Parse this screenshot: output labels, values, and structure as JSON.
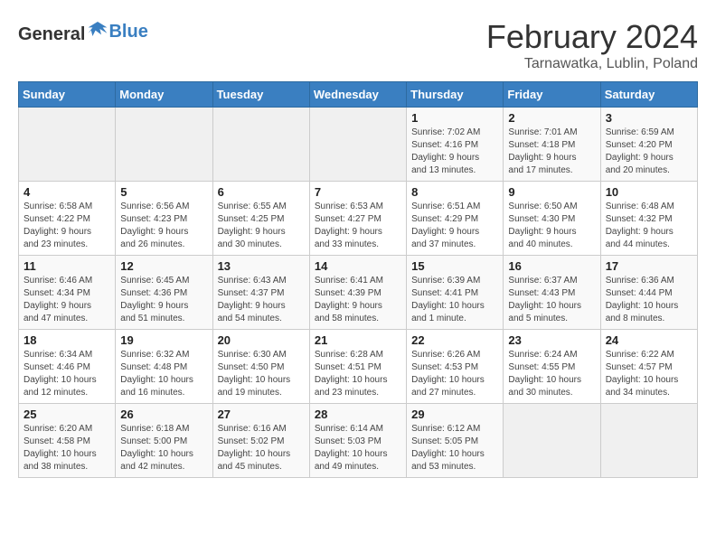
{
  "header": {
    "logo_general": "General",
    "logo_blue": "Blue",
    "month_title": "February 2024",
    "location": "Tarnawatka, Lublin, Poland"
  },
  "weekdays": [
    "Sunday",
    "Monday",
    "Tuesday",
    "Wednesday",
    "Thursday",
    "Friday",
    "Saturday"
  ],
  "weeks": [
    [
      {
        "day": "",
        "info": ""
      },
      {
        "day": "",
        "info": ""
      },
      {
        "day": "",
        "info": ""
      },
      {
        "day": "",
        "info": ""
      },
      {
        "day": "1",
        "info": "Sunrise: 7:02 AM\nSunset: 4:16 PM\nDaylight: 9 hours\nand 13 minutes."
      },
      {
        "day": "2",
        "info": "Sunrise: 7:01 AM\nSunset: 4:18 PM\nDaylight: 9 hours\nand 17 minutes."
      },
      {
        "day": "3",
        "info": "Sunrise: 6:59 AM\nSunset: 4:20 PM\nDaylight: 9 hours\nand 20 minutes."
      }
    ],
    [
      {
        "day": "4",
        "info": "Sunrise: 6:58 AM\nSunset: 4:22 PM\nDaylight: 9 hours\nand 23 minutes."
      },
      {
        "day": "5",
        "info": "Sunrise: 6:56 AM\nSunset: 4:23 PM\nDaylight: 9 hours\nand 26 minutes."
      },
      {
        "day": "6",
        "info": "Sunrise: 6:55 AM\nSunset: 4:25 PM\nDaylight: 9 hours\nand 30 minutes."
      },
      {
        "day": "7",
        "info": "Sunrise: 6:53 AM\nSunset: 4:27 PM\nDaylight: 9 hours\nand 33 minutes."
      },
      {
        "day": "8",
        "info": "Sunrise: 6:51 AM\nSunset: 4:29 PM\nDaylight: 9 hours\nand 37 minutes."
      },
      {
        "day": "9",
        "info": "Sunrise: 6:50 AM\nSunset: 4:30 PM\nDaylight: 9 hours\nand 40 minutes."
      },
      {
        "day": "10",
        "info": "Sunrise: 6:48 AM\nSunset: 4:32 PM\nDaylight: 9 hours\nand 44 minutes."
      }
    ],
    [
      {
        "day": "11",
        "info": "Sunrise: 6:46 AM\nSunset: 4:34 PM\nDaylight: 9 hours\nand 47 minutes."
      },
      {
        "day": "12",
        "info": "Sunrise: 6:45 AM\nSunset: 4:36 PM\nDaylight: 9 hours\nand 51 minutes."
      },
      {
        "day": "13",
        "info": "Sunrise: 6:43 AM\nSunset: 4:37 PM\nDaylight: 9 hours\nand 54 minutes."
      },
      {
        "day": "14",
        "info": "Sunrise: 6:41 AM\nSunset: 4:39 PM\nDaylight: 9 hours\nand 58 minutes."
      },
      {
        "day": "15",
        "info": "Sunrise: 6:39 AM\nSunset: 4:41 PM\nDaylight: 10 hours\nand 1 minute."
      },
      {
        "day": "16",
        "info": "Sunrise: 6:37 AM\nSunset: 4:43 PM\nDaylight: 10 hours\nand 5 minutes."
      },
      {
        "day": "17",
        "info": "Sunrise: 6:36 AM\nSunset: 4:44 PM\nDaylight: 10 hours\nand 8 minutes."
      }
    ],
    [
      {
        "day": "18",
        "info": "Sunrise: 6:34 AM\nSunset: 4:46 PM\nDaylight: 10 hours\nand 12 minutes."
      },
      {
        "day": "19",
        "info": "Sunrise: 6:32 AM\nSunset: 4:48 PM\nDaylight: 10 hours\nand 16 minutes."
      },
      {
        "day": "20",
        "info": "Sunrise: 6:30 AM\nSunset: 4:50 PM\nDaylight: 10 hours\nand 19 minutes."
      },
      {
        "day": "21",
        "info": "Sunrise: 6:28 AM\nSunset: 4:51 PM\nDaylight: 10 hours\nand 23 minutes."
      },
      {
        "day": "22",
        "info": "Sunrise: 6:26 AM\nSunset: 4:53 PM\nDaylight: 10 hours\nand 27 minutes."
      },
      {
        "day": "23",
        "info": "Sunrise: 6:24 AM\nSunset: 4:55 PM\nDaylight: 10 hours\nand 30 minutes."
      },
      {
        "day": "24",
        "info": "Sunrise: 6:22 AM\nSunset: 4:57 PM\nDaylight: 10 hours\nand 34 minutes."
      }
    ],
    [
      {
        "day": "25",
        "info": "Sunrise: 6:20 AM\nSunset: 4:58 PM\nDaylight: 10 hours\nand 38 minutes."
      },
      {
        "day": "26",
        "info": "Sunrise: 6:18 AM\nSunset: 5:00 PM\nDaylight: 10 hours\nand 42 minutes."
      },
      {
        "day": "27",
        "info": "Sunrise: 6:16 AM\nSunset: 5:02 PM\nDaylight: 10 hours\nand 45 minutes."
      },
      {
        "day": "28",
        "info": "Sunrise: 6:14 AM\nSunset: 5:03 PM\nDaylight: 10 hours\nand 49 minutes."
      },
      {
        "day": "29",
        "info": "Sunrise: 6:12 AM\nSunset: 5:05 PM\nDaylight: 10 hours\nand 53 minutes."
      },
      {
        "day": "",
        "info": ""
      },
      {
        "day": "",
        "info": ""
      }
    ]
  ]
}
